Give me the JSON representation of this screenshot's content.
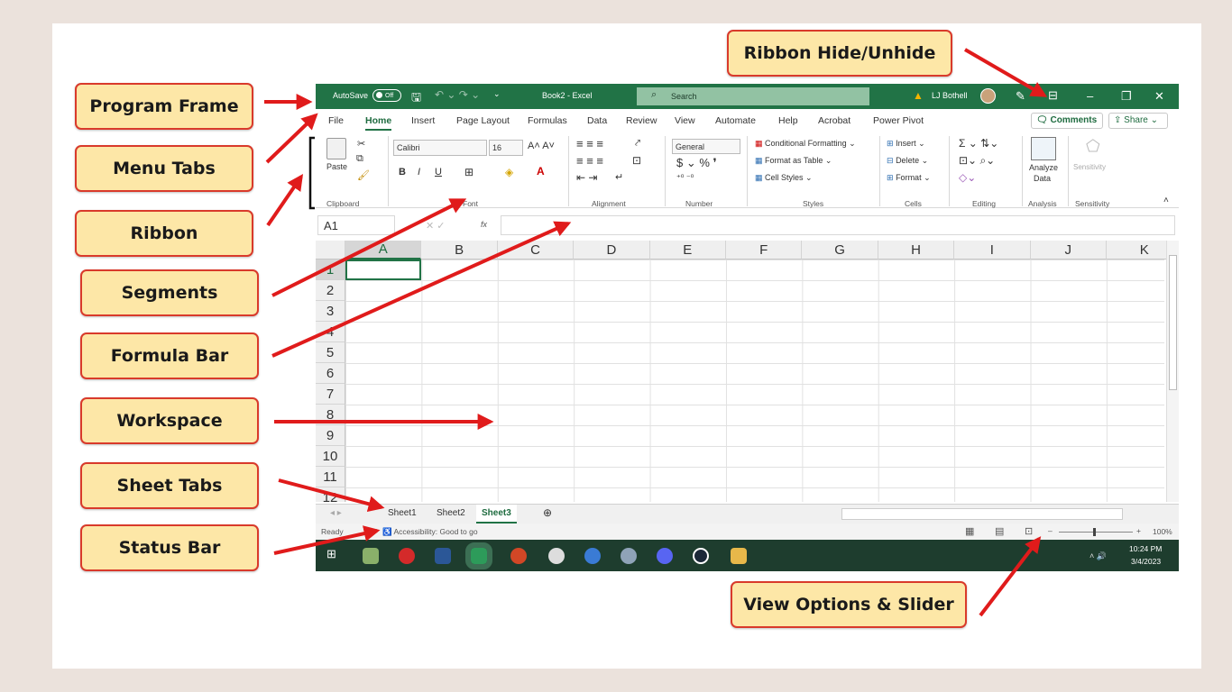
{
  "callouts": {
    "program_frame": "Program Frame",
    "menu_tabs": "Menu Tabs",
    "ribbon": "Ribbon",
    "segments": "Segments",
    "formula_bar": "Formula Bar",
    "workspace": "Workspace",
    "sheet_tabs": "Sheet Tabs",
    "status_bar": "Status Bar",
    "ribbon_hide": "Ribbon Hide/Unhide",
    "view_options": "View Options & Slider"
  },
  "colors": {
    "excel_green": "#217346",
    "callout_fill": "#fde7a7",
    "callout_border": "#d93a2b",
    "arrow": "#e01b1b"
  },
  "titlebar": {
    "autosave": "AutoSave",
    "toggle": "Off",
    "doc": "Book2  -  Excel",
    "search": "Search",
    "user": "LJ Bothell"
  },
  "menu": {
    "tabs": [
      "File",
      "Home",
      "Insert",
      "Page Layout",
      "Formulas",
      "Data",
      "Review",
      "View",
      "Automate",
      "Help",
      "Acrobat",
      "Power Pivot"
    ],
    "comments": "Comments",
    "share": "Share"
  },
  "ribbon": {
    "paste": "Paste",
    "font_name": "Calibri",
    "font_size": "16",
    "number_format": "General",
    "cond_format": "Conditional Formatting",
    "format_table": "Format as Table",
    "cell_styles": "Cell Styles",
    "insert": "Insert",
    "delete": "Delete",
    "format": "Format",
    "analyze1": "Analyze",
    "analyze2": "Data",
    "sensitivity": "Sensitivity",
    "groups": {
      "clipboard": "Clipboard",
      "font": "Font",
      "alignment": "Alignment",
      "number": "Number",
      "styles": "Styles",
      "cells": "Cells",
      "editing": "Editing",
      "analysis": "Analysis",
      "sensitivity": "Sensitivity"
    }
  },
  "formula_bar": {
    "name_box": "A1",
    "fx": "fx"
  },
  "grid": {
    "columns": [
      "A",
      "B",
      "C",
      "D",
      "E",
      "F",
      "G",
      "H",
      "I",
      "J",
      "K"
    ],
    "rows": [
      "1",
      "2",
      "3",
      "4",
      "5",
      "6",
      "7",
      "8",
      "9",
      "10",
      "11",
      "12"
    ]
  },
  "sheets": {
    "tabs": [
      "Sheet1",
      "Sheet2",
      "Sheet3"
    ],
    "active": "Sheet3"
  },
  "status": {
    "ready": "Ready",
    "accessibility": "Accessibility: Good to go",
    "zoom": "100%"
  },
  "taskbar": {
    "time": "10:24 PM",
    "date": "3/4/2023"
  }
}
